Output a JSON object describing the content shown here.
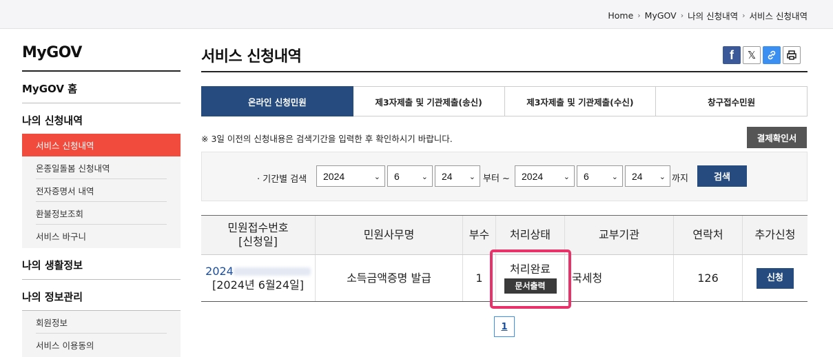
{
  "breadcrumb": [
    "Home",
    "MyGOV",
    "나의 신청내역",
    "서비스 신청내역"
  ],
  "sidebar": {
    "title": "MyGOV",
    "home": "MyGOV 홈",
    "section1": "나의 신청내역",
    "section1_items": [
      "서비스 신청내역",
      "온종일돌봄 신청내역",
      "전자증명서 내역",
      "환불정보조회",
      "서비스 바구니"
    ],
    "section2": "나의 생활정보",
    "section3": "나의 정보관리",
    "section3_items": [
      "회원정보",
      "서비스 이용동의"
    ]
  },
  "page": {
    "title": "서비스 신청내역",
    "share_icons": [
      "facebook-icon",
      "x-icon",
      "link-icon",
      "print-icon"
    ]
  },
  "tabs": [
    "온라인 신청민원",
    "제3자제출 및 기관제출(송신)",
    "제3자제출 및 기관제출(수신)",
    "창구접수민원"
  ],
  "notice": "※ 3일 이전의 신청내용은 검색기간을 입력한 후 확인하시기 바랍니다.",
  "receipt_button": "결제확인서",
  "search": {
    "label": "· 기간별 검색",
    "from_year": "2024",
    "from_month": "6",
    "from_day": "24",
    "from_suffix": "부터 ~",
    "to_year": "2024",
    "to_month": "6",
    "to_day": "24",
    "to_suffix": "까지",
    "button": "검색"
  },
  "table": {
    "headers": {
      "receipt_no": "민원접수번호",
      "apply_date": "[신청일]",
      "name": "민원사무명",
      "copies": "부수",
      "status": "처리상태",
      "agency": "교부기관",
      "contact": "연락처",
      "extra": "추가신청"
    },
    "rows": [
      {
        "receipt_no": "2024",
        "apply_date": "[2024년 6월24일]",
        "name": "소득금액증명 발급",
        "copies": "1",
        "status": "처리완료",
        "print_button": "문서출력",
        "agency": "국세청",
        "contact": "126",
        "apply_button": "신청"
      }
    ]
  },
  "pagination": [
    "1"
  ],
  "colors": {
    "navy": "#254b7f",
    "active_red": "#f14b3d",
    "highlight": "#e8336a"
  }
}
